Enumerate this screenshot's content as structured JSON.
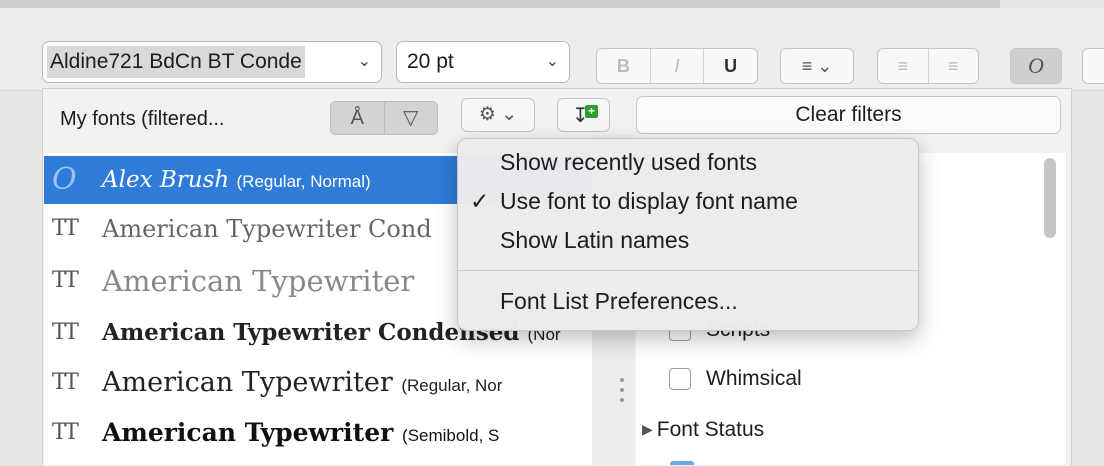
{
  "toolbar": {
    "font_family_value": "Aldine721 BdCn BT Conde",
    "font_size_value": "20 pt",
    "bold_label": "B",
    "italic_label": "I",
    "underline_label": "U",
    "last_button_label": "O"
  },
  "font_list_header": {
    "label": "My fonts (filtered..."
  },
  "clear_filters_label": "Clear filters",
  "font_list": [
    {
      "name": "Alex Brush",
      "style": "(Regular, Normal)",
      "selected": true
    },
    {
      "name": "American Typewriter Cond",
      "style": ""
    },
    {
      "name": "American Typewriter",
      "style": ""
    },
    {
      "name": "American Typewriter Condensed",
      "style": "(Nor"
    },
    {
      "name": "American Typewriter",
      "style": "(Regular, Nor"
    },
    {
      "name": "American Typewriter",
      "style": "(Semibold, S"
    }
  ],
  "filters": {
    "scripts_label": "Scripts",
    "whimsical_label": "Whimsical",
    "font_status_label": "Font Status"
  },
  "context_menu": {
    "items": [
      {
        "label": "Show recently used fonts",
        "checked": false
      },
      {
        "label": "Use font to display font name",
        "checked": true
      },
      {
        "label": "Show Latin names",
        "checked": false
      }
    ],
    "preferences_label": "Font List Preferences...",
    "check_glyph": "✓"
  },
  "colors": {
    "selection": "#2f7bd8",
    "add_badge": "#2d9e2d"
  }
}
